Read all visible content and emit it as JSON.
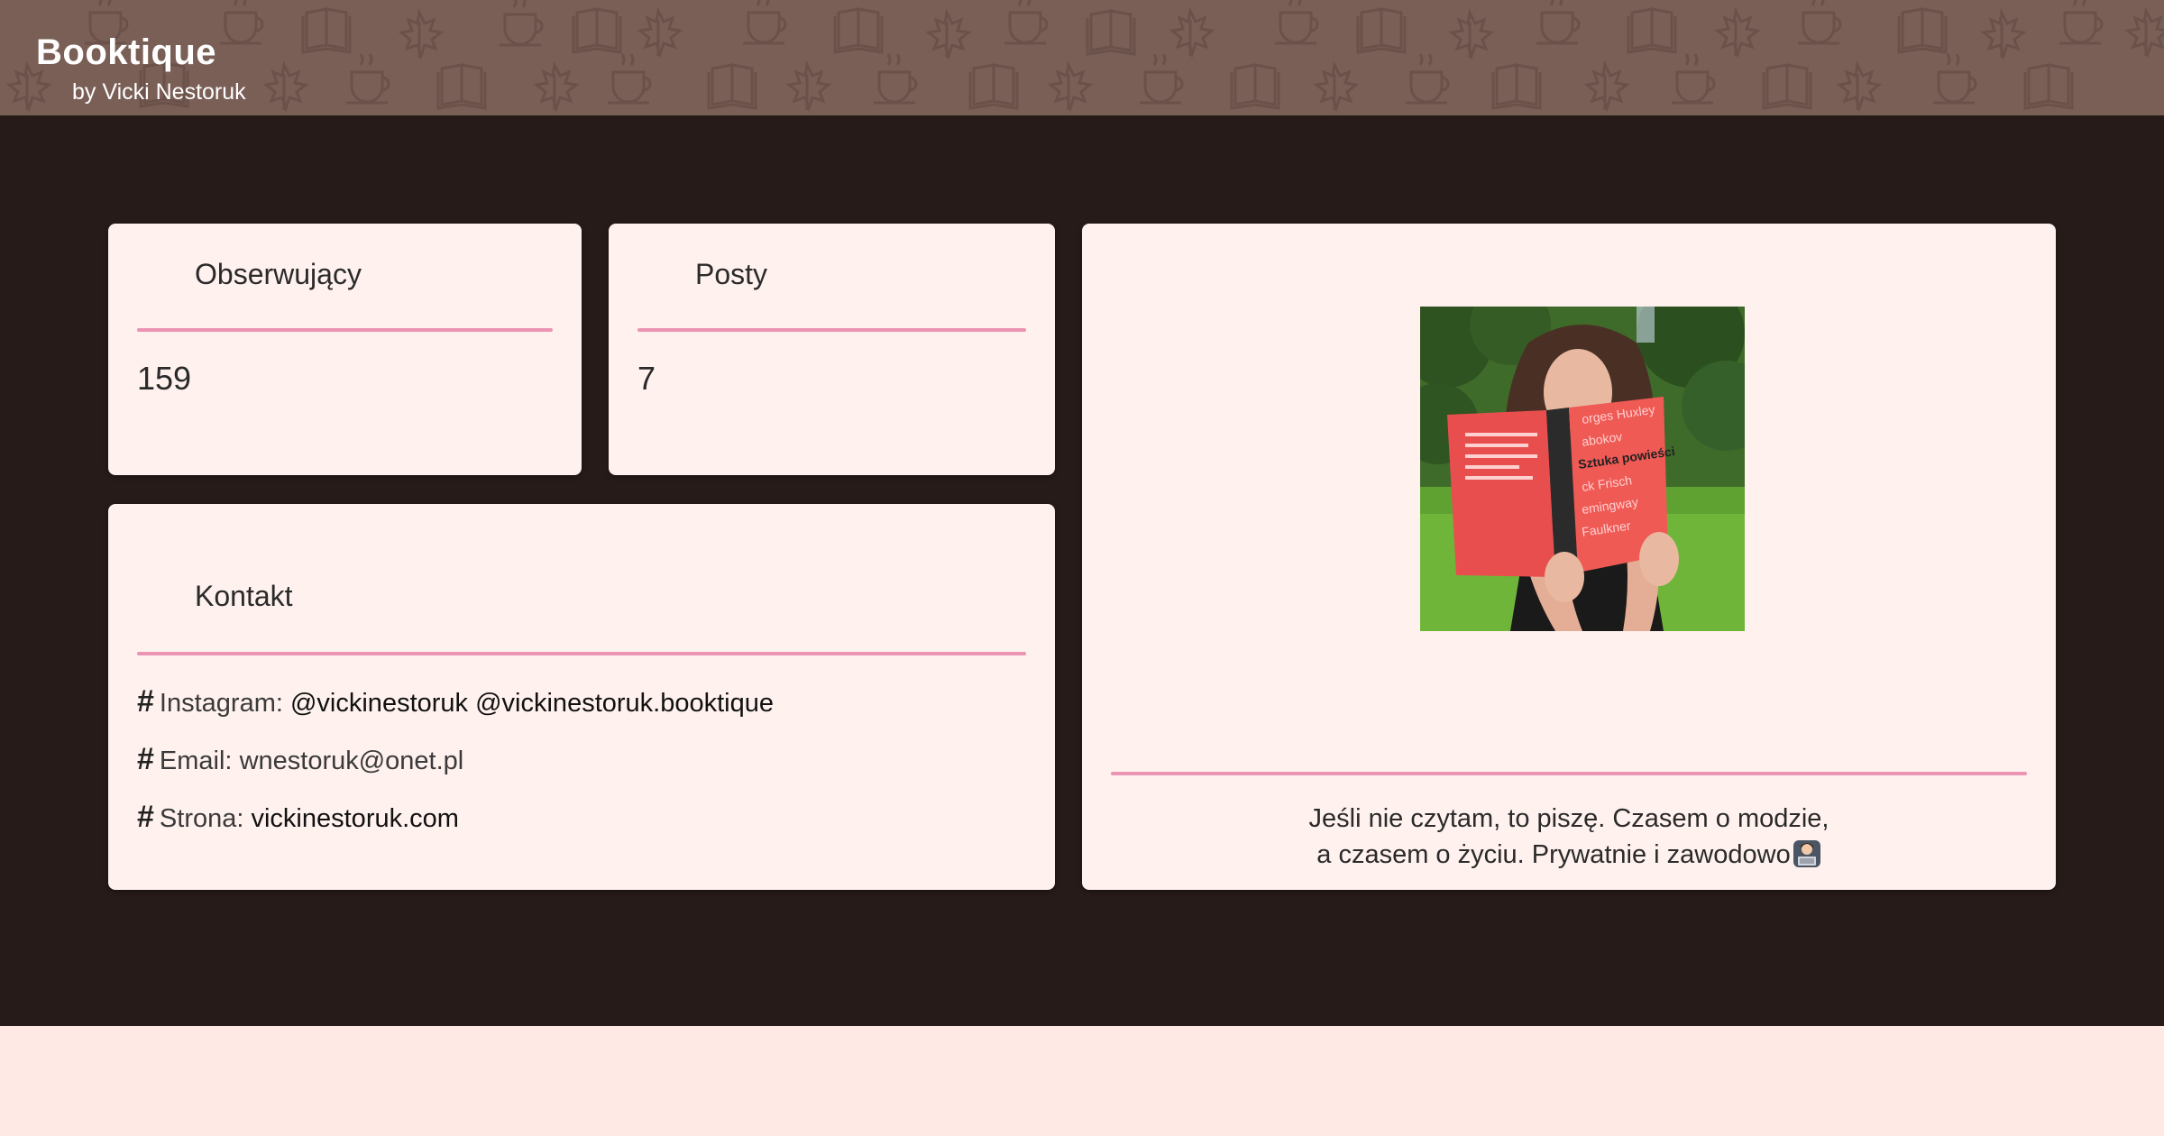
{
  "header": {
    "title": "Booktique",
    "subtitle": "by Vicki Nestoruk",
    "background_color": "#7a5f57",
    "pattern_icons": [
      "coffee-cup-icon",
      "book-icon",
      "maple-leaf-icon"
    ]
  },
  "colors": {
    "main_background": "#261b19",
    "card_background": "#fff1ee",
    "accent_rule": "#ec94b4",
    "footer_background": "#ffe9e4"
  },
  "followers": {
    "label": "Obserwujący",
    "value": "159"
  },
  "posts": {
    "label": "Posty",
    "value": "7"
  },
  "contact": {
    "label": "Kontakt",
    "instagram": {
      "label": "Instagram:",
      "handle_1": "@vickinestoruk",
      "handle_2": "@vickinestoruk.booktique"
    },
    "email": {
      "label": "Email:",
      "value": "wnestoruk@onet.pl"
    },
    "website": {
      "label": "Strona:",
      "value": "vickinestoruk.com"
    }
  },
  "profile": {
    "photo_icon": "profile-photo",
    "bio_line_1": "Jeśli nie czytam, to piszę. Czasem o modzie,",
    "bio_line_2": "a czasem o życiu. Prywatnie i zawodowo",
    "bio_emoji": "woman-at-laptop-emoji"
  }
}
